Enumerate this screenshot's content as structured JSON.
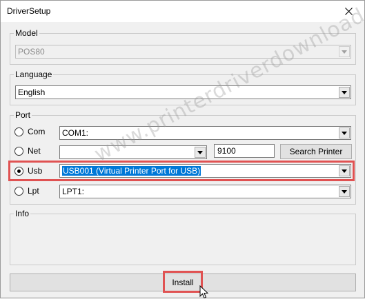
{
  "window": {
    "title": "DriverSetup"
  },
  "model": {
    "group_label": "Model",
    "selected": "POS80"
  },
  "language": {
    "group_label": "Language",
    "selected": "English"
  },
  "port": {
    "group_label": "Port",
    "com": {
      "label": "Com",
      "value": "COM1:"
    },
    "net": {
      "label": "Net",
      "value": "",
      "port": "9100",
      "search_label": "Search Printer"
    },
    "usb": {
      "label": "Usb",
      "value": "USB001 (Virtual Printer Port for USB)"
    },
    "lpt": {
      "label": "Lpt",
      "value": "LPT1:"
    },
    "selected": "Usb"
  },
  "info": {
    "group_label": "Info"
  },
  "install_label": "Install",
  "watermark": "www.printerdriverdownload.org",
  "colors": {
    "highlight": "#e05252",
    "selection": "#0078d7"
  }
}
